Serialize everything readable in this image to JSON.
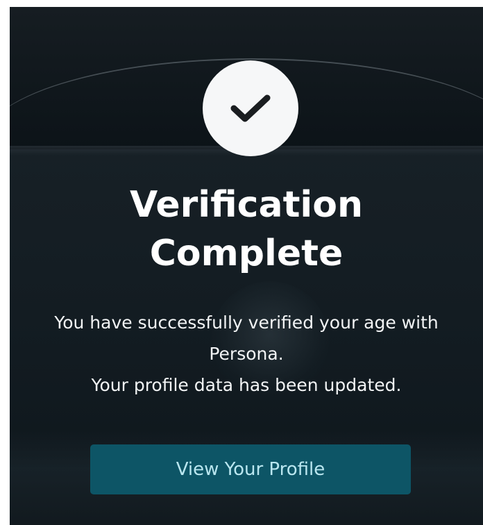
{
  "success": {
    "icon": "check-icon",
    "title_line1": "Verification",
    "title_line2": "Complete",
    "message_line1": "You have successfully verified your age with",
    "message_line2": "Persona.",
    "message_line3": "Your profile data has been updated."
  },
  "actions": {
    "view_profile_label": "View Your Profile"
  },
  "colors": {
    "background": "#10171c",
    "button": "#0d5566",
    "button_text": "#b9e6ef",
    "icon_circle": "#f6f7f8",
    "check_mark": "#1a1d20"
  }
}
